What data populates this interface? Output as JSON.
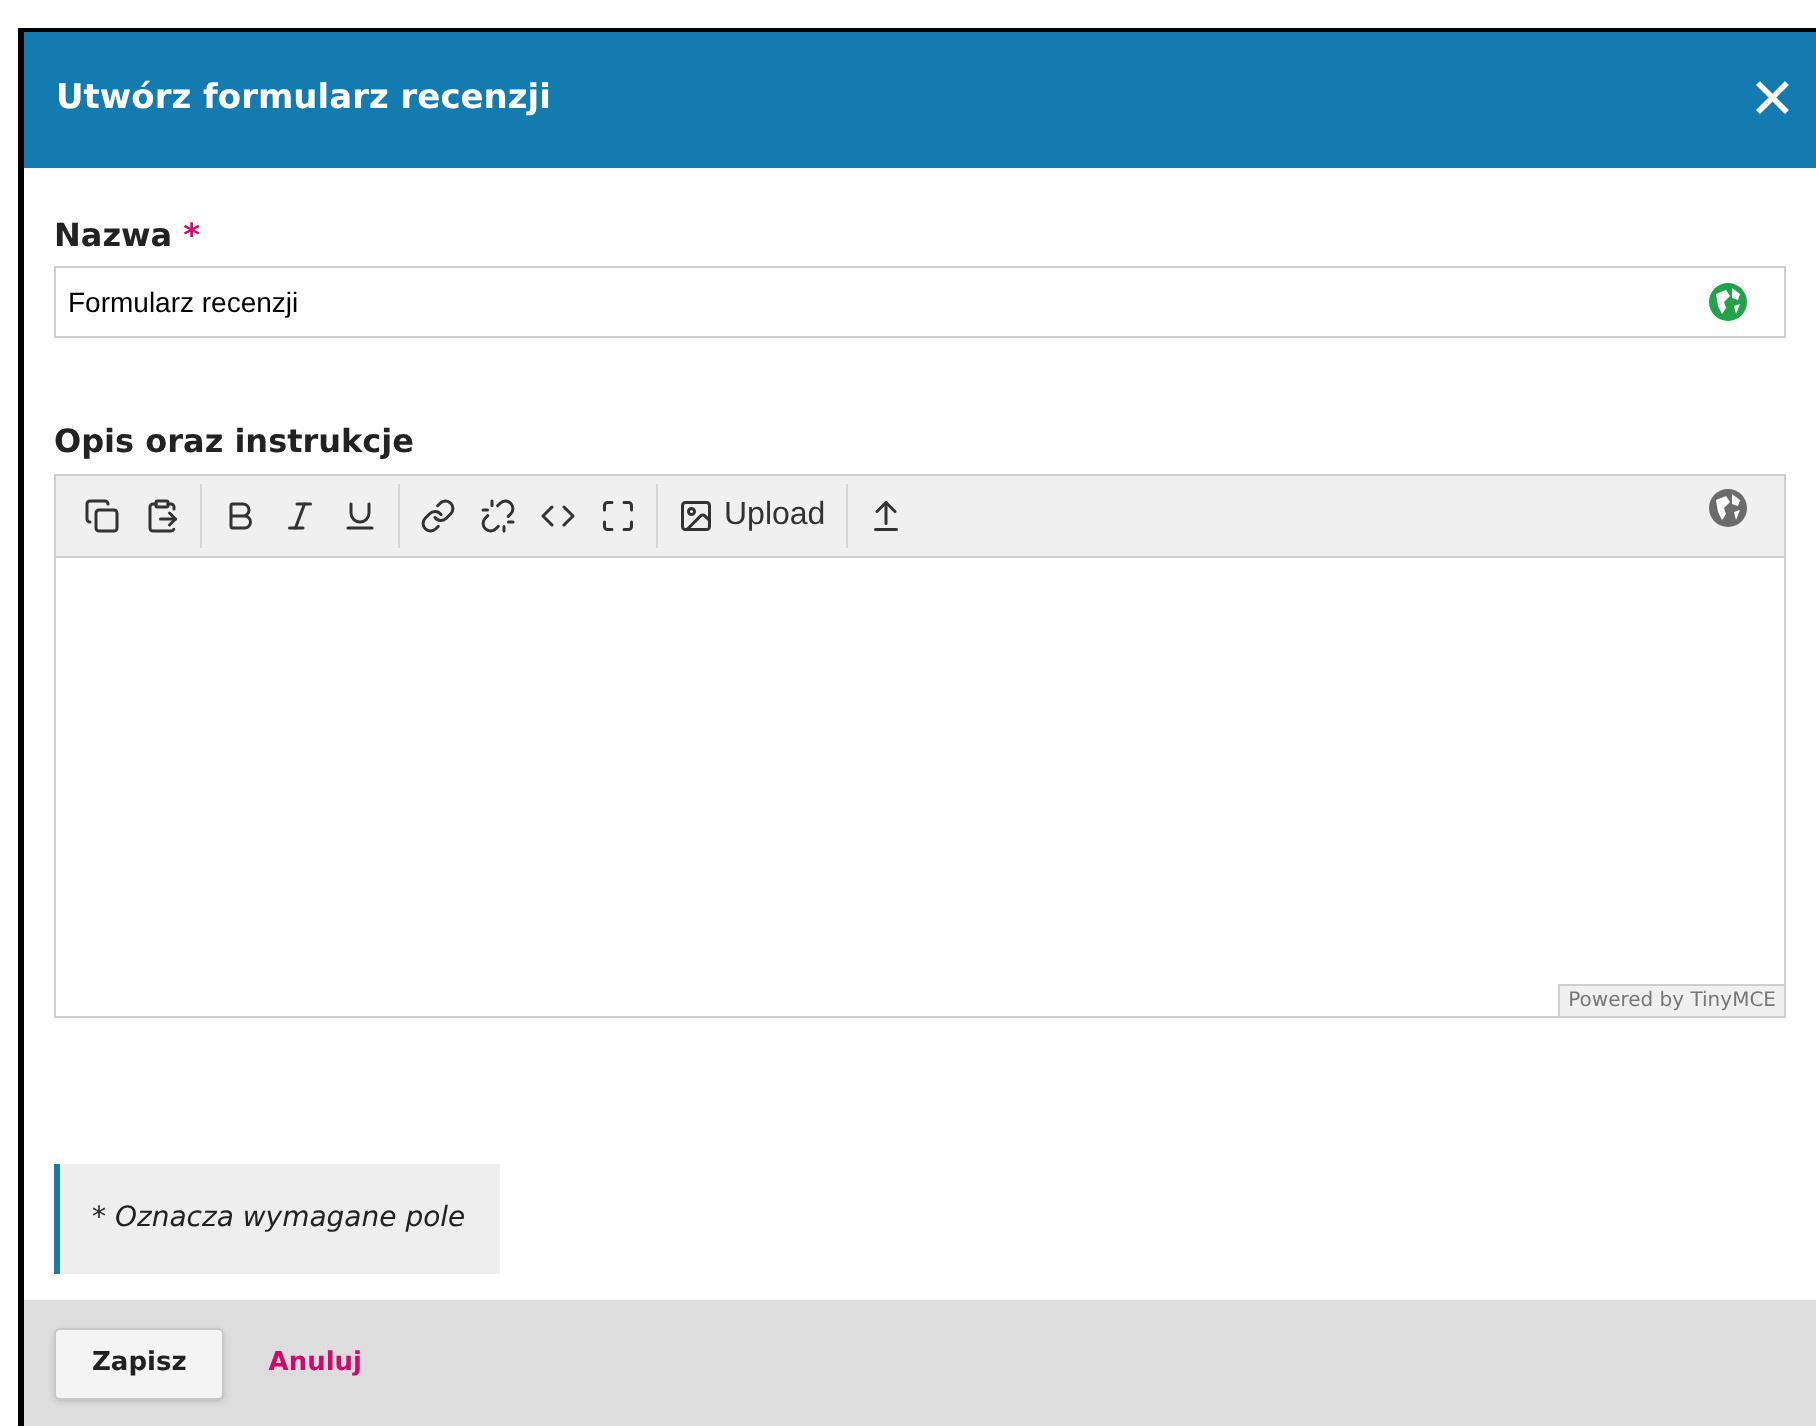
{
  "dialog": {
    "title": "Utwórz formularz recenzji",
    "close": "✕"
  },
  "name_field": {
    "label": "Nazwa",
    "required_mark": "*",
    "value": "Formularz recenzji",
    "translated": true
  },
  "description_field": {
    "label": "Opis oraz instrukcje",
    "upload_label": "Upload",
    "translated": false,
    "powered_by": "Powered by TinyMCE"
  },
  "note": "* Oznacza wymagane pole",
  "buttons": [
    {
      "label": "Zapisz",
      "kind": "primary"
    },
    {
      "label": "Anuluj",
      "kind": "link"
    }
  ]
}
